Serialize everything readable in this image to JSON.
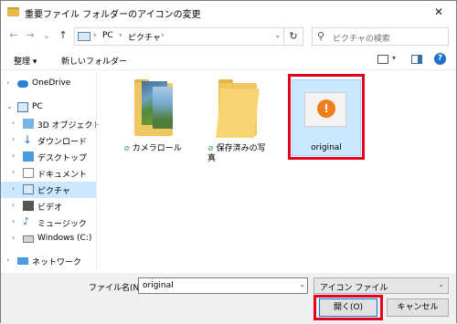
{
  "window": {
    "title": "重要ファイル フォルダーのアイコンの変更",
    "close_glyph": "✕"
  },
  "nav": {
    "back_glyph": "←",
    "forward_glyph": "→",
    "recent_glyph": "⌄",
    "up_glyph": "↑",
    "breadcrumb": [
      "PC",
      "ピクチャ"
    ],
    "refresh_glyph": "↻",
    "search_placeholder": "ピクチャの検索"
  },
  "toolbar": {
    "organize_label": "整理 ▾",
    "new_folder_label": "新しいフォルダー"
  },
  "sidebar": {
    "items": [
      {
        "label": "OneDrive",
        "icon": "cloud-icon"
      },
      {
        "label": "PC",
        "icon": "pc-icon"
      },
      {
        "label": "3D オブジェクト",
        "icon": "3d-objects-icon"
      },
      {
        "label": "ダウンロード",
        "icon": "download-icon"
      },
      {
        "label": "デスクトップ",
        "icon": "desktop-icon"
      },
      {
        "label": "ドキュメント",
        "icon": "documents-icon"
      },
      {
        "label": "ピクチャ",
        "icon": "pictures-icon"
      },
      {
        "label": "ビデオ",
        "icon": "video-icon"
      },
      {
        "label": "ミュージック",
        "icon": "music-icon"
      },
      {
        "label": "Windows (C:)",
        "icon": "drive-icon"
      },
      {
        "label": "ネットワーク",
        "icon": "network-icon"
      }
    ]
  },
  "files": [
    {
      "name": "カメラロール",
      "status": "synced"
    },
    {
      "name": "保存済みの写真",
      "status": "synced"
    },
    {
      "name": "original",
      "status": "selected"
    }
  ],
  "bottom": {
    "filename_label": "ファイル名(N):",
    "filename_value": "original",
    "filetype_value": "アイコン ファイル",
    "open_label": "開く(O)",
    "cancel_label": "キャンセル"
  },
  "colors": {
    "highlight": "#e5001c",
    "selection": "#cce8ff",
    "accent": "#0078d7"
  }
}
